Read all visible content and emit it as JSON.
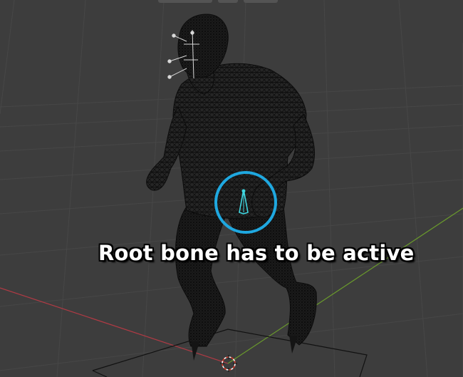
{
  "viewport": {
    "annotation_text": "Root bone has to be active",
    "highlight_color": "#1fa8e0",
    "bone_color": "#3fd6e0",
    "x_axis_color": "#b03a44",
    "y_axis_color": "#6a9a2c",
    "grid_color": "#464646",
    "mesh_color": "#111111"
  }
}
